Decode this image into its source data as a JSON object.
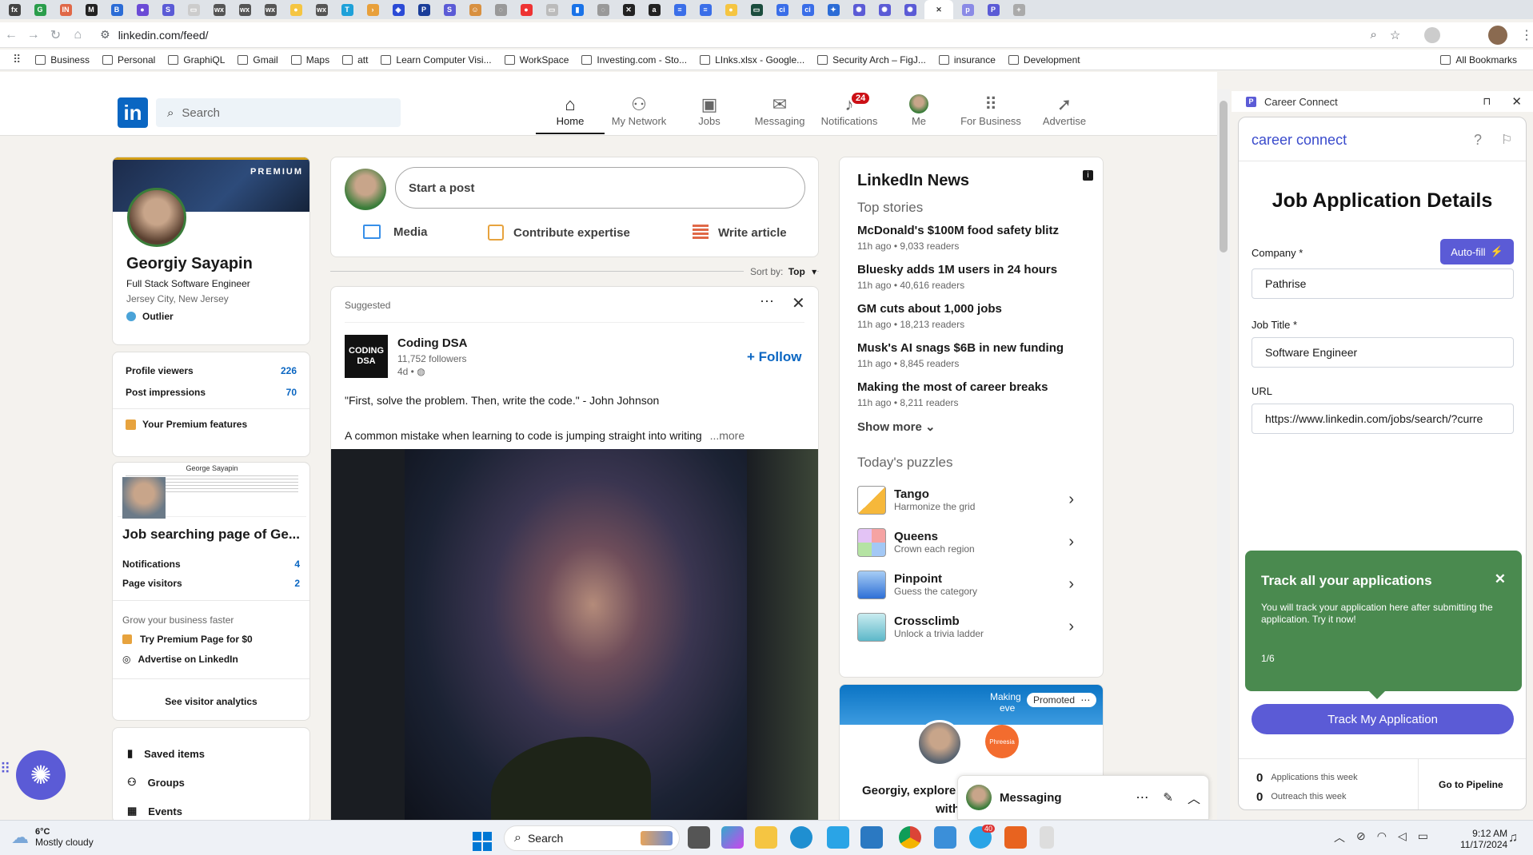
{
  "browser": {
    "url": "linkedin.com/feed/",
    "bookmarks": [
      "Business",
      "Personal",
      "GraphiQL",
      "Gmail",
      "Maps",
      "att",
      "Learn Computer Visi...",
      "WorkSpace",
      "Investing.com - Sto...",
      "LInks.xlsx - Google...",
      "Security Arch – FigJ...",
      "insurance",
      "Development"
    ],
    "all_bookmarks": "All Bookmarks",
    "tab_icons": [
      "fx",
      "G",
      "IN",
      "M",
      "B",
      "●",
      "S",
      "▭",
      "wx",
      "wx",
      "wx",
      "●",
      "wx",
      "T",
      "›",
      "◈",
      "P",
      "S",
      "☺",
      "◌",
      "●",
      "▭",
      "▮",
      "◌",
      "✕",
      "a",
      "≡",
      "≡",
      "●",
      "▭",
      "ci",
      "ci",
      "✦",
      "✺",
      "✺",
      "✺",
      "✕",
      "p",
      "P",
      "+"
    ]
  },
  "linkedin": {
    "search_placeholder": "Search",
    "nav": [
      {
        "label": "Home",
        "icon": "home-icon"
      },
      {
        "label": "My Network",
        "icon": "network-icon"
      },
      {
        "label": "Jobs",
        "icon": "jobs-icon"
      },
      {
        "label": "Messaging",
        "icon": "messaging-icon"
      },
      {
        "label": "Notifications",
        "icon": "bell-icon",
        "badge": "24"
      },
      {
        "label": "Me",
        "icon": "avatar"
      },
      {
        "label": "For Business",
        "icon": "grid-icon"
      },
      {
        "label": "Advertise",
        "icon": "advertise-icon"
      }
    ],
    "profile": {
      "premium": "PREMIUM",
      "name": "Georgiy Sayapin",
      "headline": "Full Stack Software Engineer",
      "location": "Jersey City, New Jersey",
      "org": "Outlier",
      "stats": [
        {
          "label": "Profile viewers",
          "value": "226"
        },
        {
          "label": "Post impressions",
          "value": "70"
        }
      ],
      "premium_features": "Your Premium features"
    },
    "page": {
      "header_name": "George Sayapin",
      "title": "Job searching page of Ge...",
      "stats": [
        {
          "label": "Notifications",
          "value": "4"
        },
        {
          "label": "Page visitors",
          "value": "2"
        }
      ],
      "grow": "Grow your business faster",
      "premium_page": "Try Premium Page for $0",
      "advertise": "Advertise on LinkedIn",
      "analytics": "See visitor analytics"
    },
    "shortcuts": [
      "Saved items",
      "Groups",
      "Events"
    ],
    "composer": {
      "placeholder": "Start a post",
      "actions": [
        "Media",
        "Contribute expertise",
        "Write article"
      ]
    },
    "sort": {
      "label": "Sort by:",
      "value": "Top"
    },
    "post": {
      "suggested": "Suggested",
      "author": "Coding DSA",
      "logo_text": "CODING DSA",
      "followers": "11,752 followers",
      "age": "4d •",
      "follow": "+ Follow",
      "line1": "\"First, solve the problem. Then, write the code.\" - John Johnson",
      "line2": "A common mistake when learning to code is jumping straight into writing",
      "more": "...more"
    },
    "news": {
      "title": "LinkedIn News",
      "subtitle": "Top stories",
      "stories": [
        {
          "title": "McDonald's $100M food safety blitz",
          "meta": "11h ago • 9,033 readers"
        },
        {
          "title": "Bluesky adds 1M users in 24 hours",
          "meta": "11h ago • 40,616 readers"
        },
        {
          "title": "GM cuts about 1,000 jobs",
          "meta": "11h ago • 18,213 readers"
        },
        {
          "title": "Musk's AI snags $6B in new funding",
          "meta": "11h ago • 8,845 readers"
        },
        {
          "title": "Making the most of career breaks",
          "meta": "11h ago • 8,211 readers"
        }
      ],
      "show_more": "Show more",
      "puzzles_title": "Today's puzzles",
      "puzzles": [
        {
          "name": "Tango",
          "sub": "Harmonize the grid"
        },
        {
          "name": "Queens",
          "sub": "Crown each region"
        },
        {
          "name": "Pinpoint",
          "sub": "Guess the category"
        },
        {
          "name": "Crossclimb",
          "sub": "Unlock a trivia ladder"
        }
      ]
    },
    "ad": {
      "promoted": "Promoted",
      "banner_text": "Making",
      "banner_text2": "eve",
      "logo": "Phreesia",
      "text": "Georgiy, explore",
      "text2": "with"
    },
    "messaging": "Messaging"
  },
  "career_connect": {
    "window_title": "Career Connect",
    "brand": "career connect",
    "heading": "Job Application Details",
    "autofill": "Auto-fill",
    "fields": [
      {
        "label": "Company *",
        "value": "Pathrise"
      },
      {
        "label": "Job Title *",
        "value": "Software Engineer"
      },
      {
        "label": "URL",
        "value": "https://www.linkedin.com/jobs/search/?curre"
      }
    ],
    "tooltip": {
      "title": "Track all your applications",
      "body": "You will track your application here after submitting the application. Try it now!",
      "step": "1/6"
    },
    "track_button": "Track My Application",
    "stats": [
      {
        "value": "0",
        "label": "Applications this week"
      },
      {
        "value": "0",
        "label": "Outreach this week"
      }
    ],
    "pipeline": "Go to Pipeline"
  },
  "taskbar": {
    "temp": "6°C",
    "weather": "Mostly cloudy",
    "search": "Search",
    "time": "9:12 AM",
    "date": "11/17/2024",
    "telegram_badge": "40"
  },
  "colors": {
    "linkedin_blue": "#0a66c2",
    "cc_purple": "#5b5bd6",
    "cc_green": "#4a8a4f"
  }
}
